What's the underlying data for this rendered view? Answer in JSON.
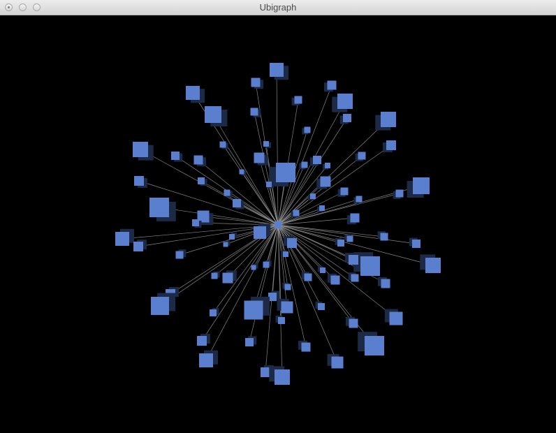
{
  "window": {
    "title": "Ubigraph"
  },
  "controls": {
    "close_icon": "close-icon",
    "minimize_icon": "minimize-icon",
    "zoom_icon": "zoom-icon"
  },
  "graph": {
    "background_color": "#000000",
    "node_color": "#5b7fcf",
    "node_shadow_color": "#1d2a45",
    "edge_color": "#9a9a9a",
    "node_shape": "cube"
  }
}
